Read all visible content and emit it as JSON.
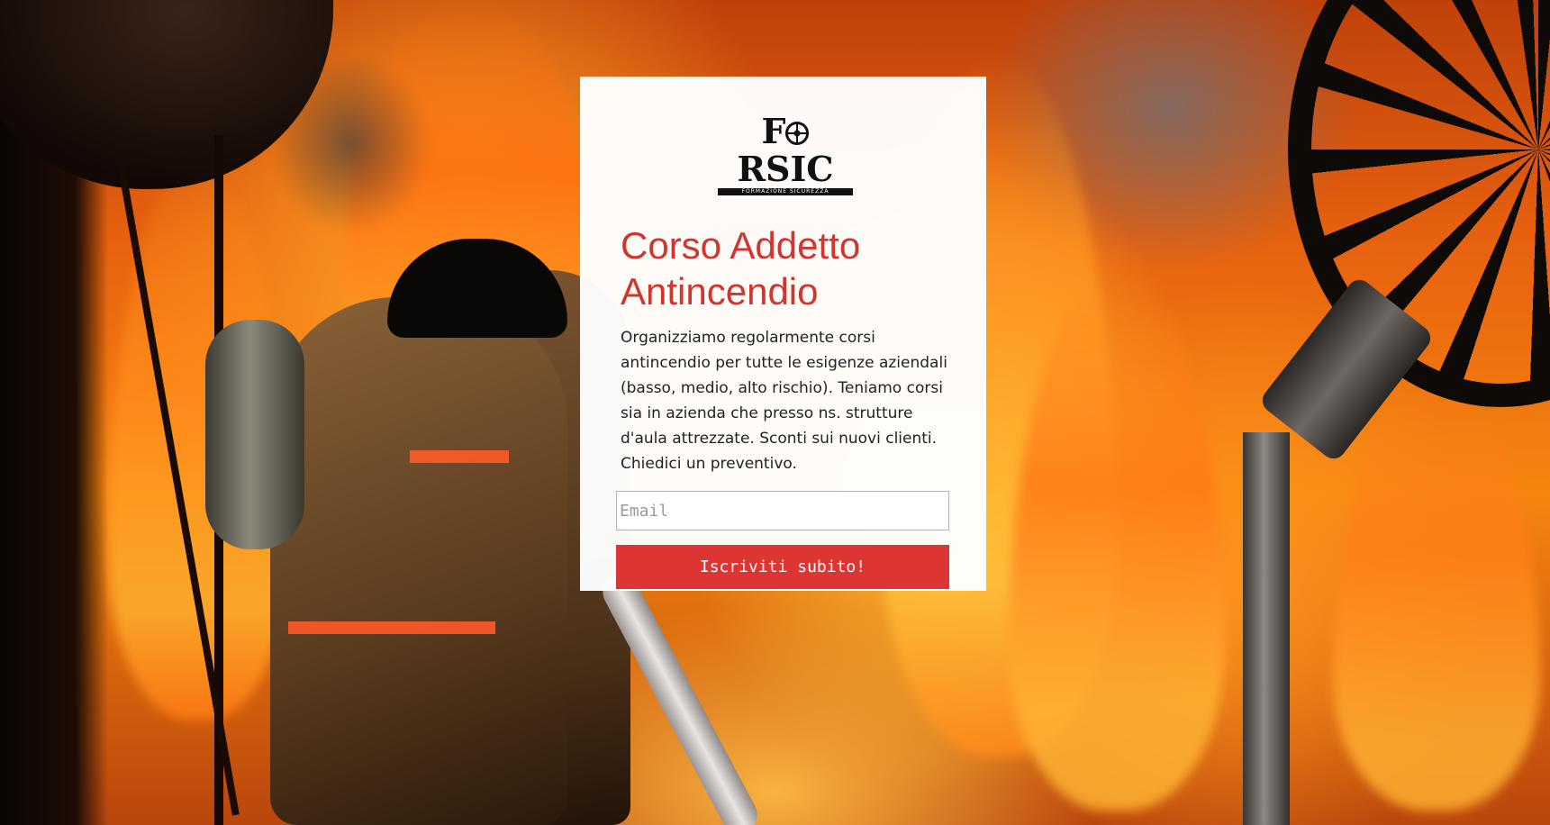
{
  "brand": {
    "logo_word_prefix": "F",
    "logo_word_suffix": "RSIC",
    "logo_subtitle": "FORMAZIONE SICUREZZA"
  },
  "card": {
    "title": "Corso Addetto Antincendio",
    "description": "Organizziamo regolarmente corsi antincendio per tutte le esigenze aziendali (basso, medio, alto rischio). Teniamo corsi sia in azienda che presso ns. strutture d'aula attrezzate. Sconti sui nuovi clienti. Chiedici un preventivo.",
    "email_placeholder": "Email",
    "email_value": "",
    "submit_label": "Iscriviti subito!"
  },
  "colors": {
    "accent": "#dd3434",
    "title": "#d03530",
    "card_background": "#ffffff"
  },
  "background": {
    "icon": "firefighters-fire-photo"
  }
}
